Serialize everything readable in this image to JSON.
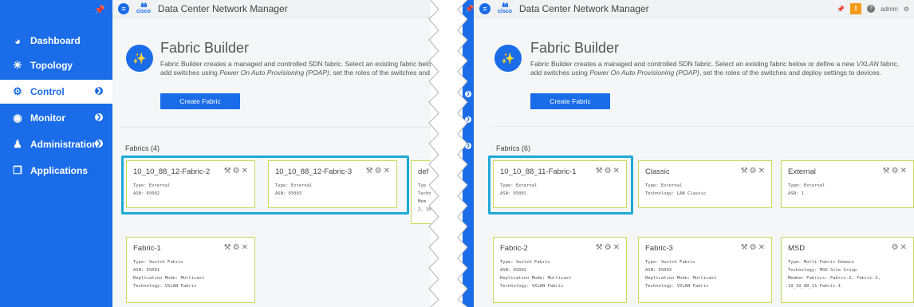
{
  "app": {
    "title": "Data Center Network Manager",
    "brand_top": "ılıılı",
    "brand_bottom": "cisco"
  },
  "sidebar": {
    "items": [
      {
        "label": "Dashboard",
        "icon": "dashboard-icon"
      },
      {
        "label": "Topology",
        "icon": "topology-icon"
      },
      {
        "label": "Control",
        "icon": "control-icon",
        "active": true
      },
      {
        "label": "Monitor",
        "icon": "monitor-icon"
      },
      {
        "label": "Administration",
        "icon": "administration-icon"
      },
      {
        "label": "Applications",
        "icon": "applications-icon"
      }
    ]
  },
  "header": {
    "user": "admin"
  },
  "fabric_builder": {
    "title": "Fabric Builder",
    "desc_line1_a": "Fabric Builder creates a managed and controlled SDN fabric. Select an existing fabric below or define a new ",
    "desc_line1_em": "VXLAN",
    "desc_line1_b": " fabric,",
    "desc_line2_a": "add switches using ",
    "desc_line2_em": "Power On Auto Provisioning (POAP)",
    "desc_line2_b": ", set the roles of the switches and deploy settings to devices.",
    "create_button": "Create Fabric"
  },
  "left": {
    "fabrics_heading": "Fabrics (4)",
    "cards": [
      {
        "name": "10_10_88_12-Fabric-2",
        "details": "Type: External\nASN: 65002"
      },
      {
        "name": "10_10_88_12-Fabric-3",
        "details": "Type: External\nASN: 65003"
      },
      {
        "name": "Fabric-1",
        "details": "Type: Switch Fabric\nASN: 65001\nReplication Mode: Multicast\nTechnology: VXLAN Fabric"
      }
    ],
    "partial_card": {
      "name": "def",
      "details": "Typ\nTechno\nMem\n2, 10"
    }
  },
  "right": {
    "fabrics_heading": "Fabrics (6)",
    "cards": [
      {
        "name": "10_10_88_11-Fabric-1",
        "details": "Type: External\nASN: 65001"
      },
      {
        "name": "Classic",
        "details": "Type: External\nTechnology: LAN Classic"
      },
      {
        "name": "External",
        "details": "Type: External\nASN: 1"
      },
      {
        "name": "Fabric-2",
        "details": "Type: Switch Fabric\nASN: 65002\nReplication Mode: Multicast\nTechnology: VXLAN Fabric"
      },
      {
        "name": "Fabric-3",
        "details": "Type: Switch Fabric\nASN: 65003\nReplication Mode: Multicast\nTechnology: VXLAN Fabric"
      },
      {
        "name": "MSD",
        "details": "Type: Multi-Fabric Domain\nTechnology: MSD Site Group\nMember Fabrics: Fabric-2, Fabric-3,\n10_10_88_11-Fabric-1"
      }
    ]
  },
  "colors": {
    "accent": "#1a6ce8",
    "highlight": "#1fa9d6",
    "card_border": "#c8d95a",
    "warning": "#f59b1a"
  }
}
